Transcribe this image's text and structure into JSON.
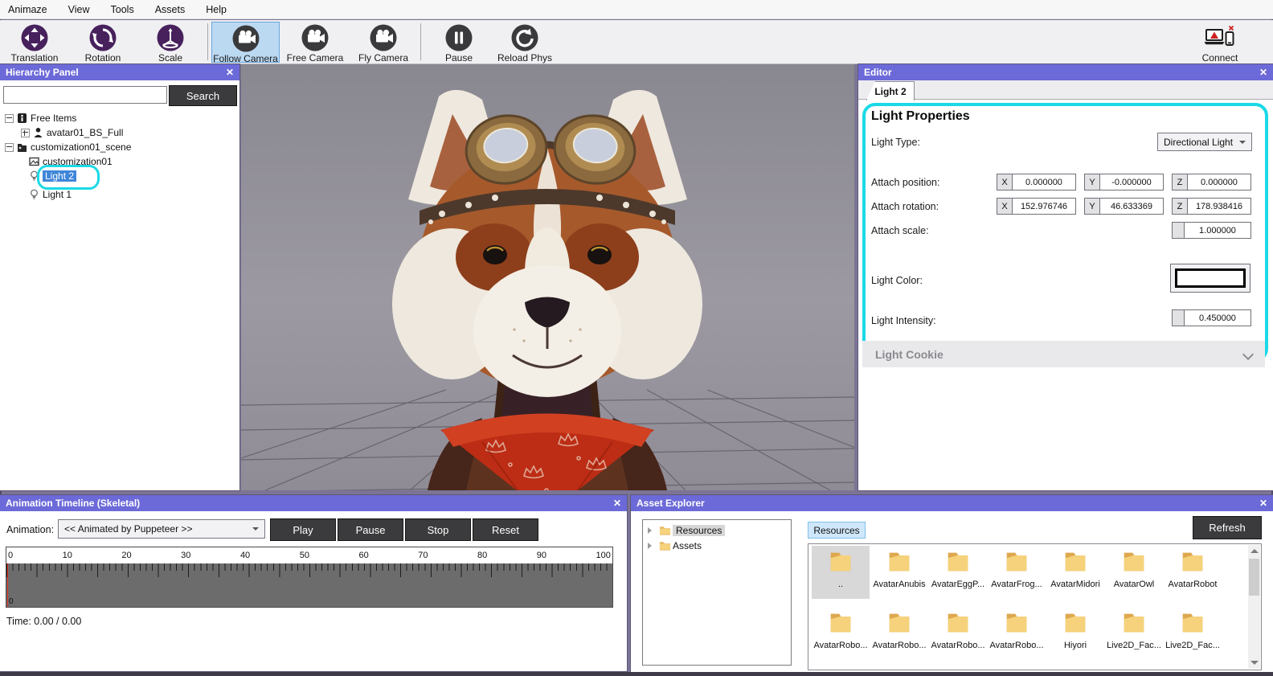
{
  "menu": {
    "items": [
      "Animaze",
      "View",
      "Tools",
      "Assets",
      "Help"
    ]
  },
  "toolbar": {
    "translation": "Translation",
    "rotation": "Rotation",
    "scale": "Scale",
    "follow_camera": "Follow Camera",
    "free_camera": "Free Camera",
    "fly_camera": "Fly Camera",
    "pause": "Pause",
    "reload_phys": "Reload Phys",
    "connect": "Connect"
  },
  "hierarchy": {
    "title": "Hierarchy Panel",
    "search_button": "Search",
    "tree": {
      "free_items": "Free Items",
      "avatar": "avatar01_BS_Full",
      "scene": "customization01_scene",
      "customization": "customization01",
      "light2": "Light 2",
      "light1": "Light 1"
    }
  },
  "editor": {
    "title": "Editor",
    "tab": "Light 2",
    "section_title": "Light Properties",
    "light_type_label": "Light Type:",
    "light_type_value": "Directional Light",
    "attach_position_label": "Attach position:",
    "attach_rotation_label": "Attach rotation:",
    "attach_scale_label": "Attach scale:",
    "light_color_label": "Light Color:",
    "light_intensity_label": "Light Intensity:",
    "axis": {
      "x": "X",
      "y": "Y",
      "z": "Z"
    },
    "position": {
      "x": "0.000000",
      "y": "-0.000000",
      "z": "0.000000"
    },
    "rotation": {
      "x": "152.976746",
      "y": "46.633369",
      "z": "178.938416"
    },
    "scale_value": "1.000000",
    "intensity_value": "0.450000",
    "light_cookie_label": "Light Cookie"
  },
  "timeline": {
    "title": "Animation Timeline (Skeletal)",
    "animation_label": "Animation:",
    "animation_value": "<< Animated by Puppeteer >>",
    "play": "Play",
    "pause": "Pause",
    "stop": "Stop",
    "reset": "Reset",
    "ruler": [
      "0",
      "10",
      "20",
      "30",
      "40",
      "50",
      "60",
      "70",
      "80",
      "90",
      "100"
    ],
    "ruler_origin": "0",
    "time_text": "Time: 0.00 / 0.00"
  },
  "assets": {
    "title": "Asset Explorer",
    "tree": {
      "resources": "Resources",
      "assets": "Assets"
    },
    "breadcrumb": "Resources",
    "refresh": "Refresh",
    "folders_row1": [
      "..",
      "AvatarAnubis",
      "AvatarEggP...",
      "AvatarFrog...",
      "AvatarMidori",
      "AvatarOwl",
      "AvatarRobot"
    ],
    "folders_row2": [
      "AvatarRobo...",
      "AvatarRobo...",
      "AvatarRobo...",
      "AvatarRobo...",
      "Hiyori",
      "Live2D_Fac...",
      "Live2D_Fac..."
    ]
  },
  "ui": {
    "close": "✕"
  },
  "colors": {
    "panel_header": "#6c6ad8",
    "annotation_cyan": "#1bd9e6",
    "selection_blue": "#3f86d9",
    "toolbar_selected": "#bcd9f2",
    "dark_button": "#3b3b3d"
  }
}
